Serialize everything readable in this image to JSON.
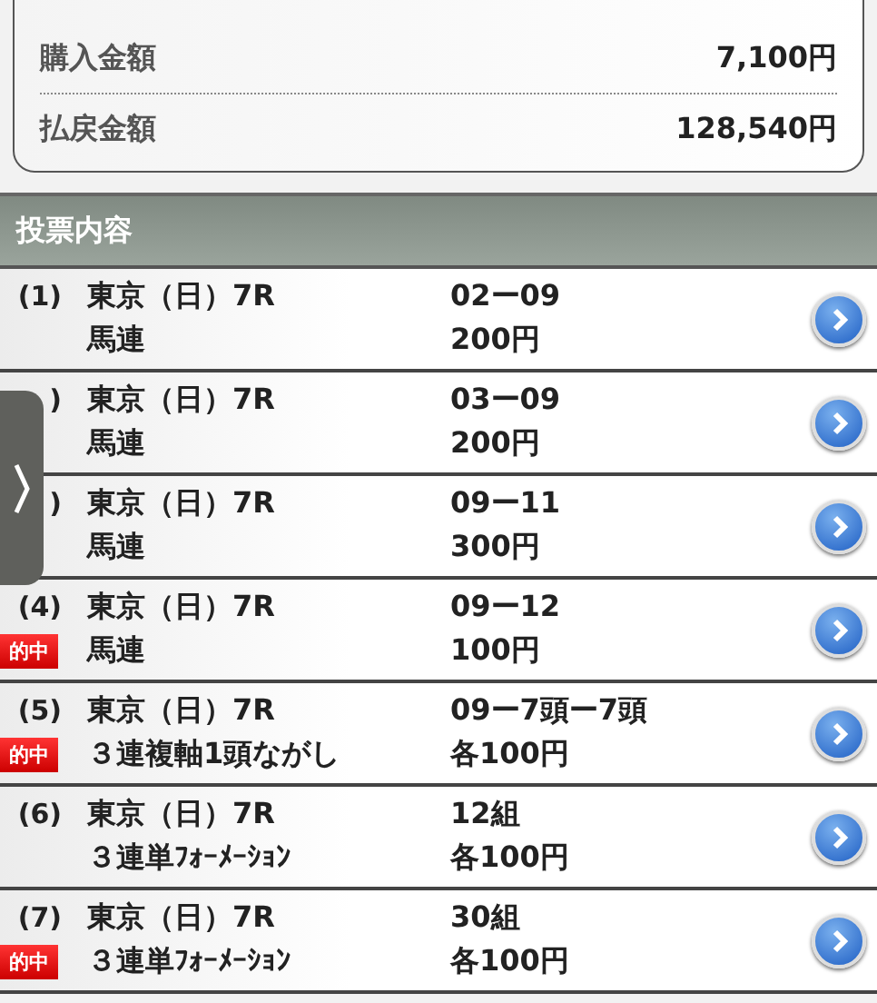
{
  "summary": [
    {
      "label": "購入金額",
      "value": "7,100円"
    },
    {
      "label": "払戻金額",
      "value": "128,540円"
    }
  ],
  "section_title": "投票内容",
  "bets": [
    {
      "number": "(1)",
      "race": "東京（日）7R",
      "bet_type": "馬連",
      "combination": "02ー09",
      "amount": "200円"
    },
    {
      "number": ")",
      "race": "東京（日）7R",
      "bet_type": "馬連",
      "combination": "03ー09",
      "amount": "200円"
    },
    {
      "number": ")",
      "race": "東京（日）7R",
      "bet_type": "馬連",
      "combination": "09ー11",
      "amount": "300円"
    },
    {
      "number": "(4)",
      "badge": "的中",
      "race": "東京（日）7R",
      "bet_type": "馬連",
      "combination": "09ー12",
      "amount": "100円"
    },
    {
      "number": "(5)",
      "badge": "的中",
      "race": "東京（日）7R",
      "bet_type": "３連複軸1頭ながし",
      "combination": "09ー7頭ー7頭",
      "amount": "各100円"
    },
    {
      "number": "(6)",
      "race": "東京（日）7R",
      "bet_type": "３連単ﾌｫｰﾒｰｼｮﾝ",
      "combination": "12組",
      "amount": "各100円"
    },
    {
      "number": "(7)",
      "badge": "的中",
      "race": "東京（日）7R",
      "bet_type": "３連単ﾌｫｰﾒｰｼｮﾝ",
      "combination": "30組",
      "amount": "各100円"
    }
  ]
}
